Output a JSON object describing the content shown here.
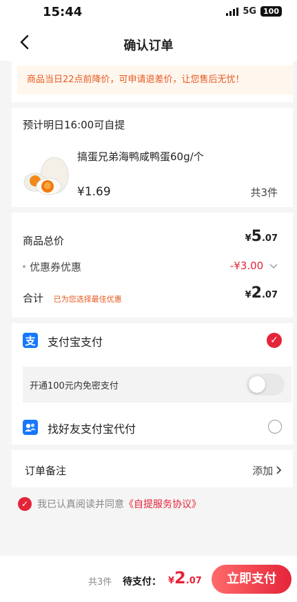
{
  "status": {
    "time": "15:44",
    "network": "5G",
    "battery": "100"
  },
  "nav": {
    "back_icon": "chevron-left-icon",
    "title": "确认订单"
  },
  "notice": {
    "text": "商品当日22点前降价，可申请退差价，让您售后无忧！"
  },
  "order": {
    "pickup": "预计明日16:00可自提",
    "product_name": "搞蛋兄弟海鸭咸鸭蛋60g/个",
    "price": "¥1.69",
    "quantity": "共3件"
  },
  "summary": {
    "total_label": "商品总价",
    "total_yen": "¥",
    "total_int": "5",
    "total_dec": ".07",
    "coupon_label": "优惠券优惠",
    "coupon_value": "-¥3.00",
    "subtotal_label": "合计",
    "subtotal_note": "已为您选择最佳优惠",
    "subtotal_yen": "¥",
    "subtotal_int": "2",
    "subtotal_dec": ".07"
  },
  "payment": {
    "alipay_label": "支付宝支付",
    "nopwd_label": "开通100元内免密支付",
    "friend_label": "找好友支付宝代付"
  },
  "remark": {
    "label": "订单备注",
    "action": "添加"
  },
  "agreement": {
    "prefix": "我已认真阅读并同意",
    "link": "《自提服务协议》"
  },
  "bottom": {
    "count": "共3件",
    "due_label": "待支付：",
    "yen": "¥",
    "amount_int": "2",
    "amount_dec": ".07",
    "pay_button": "立即支付"
  },
  "colors": {
    "accent": "#e5243a",
    "notice_text": "#e65a1f",
    "alipay_blue": "#1677ff"
  }
}
